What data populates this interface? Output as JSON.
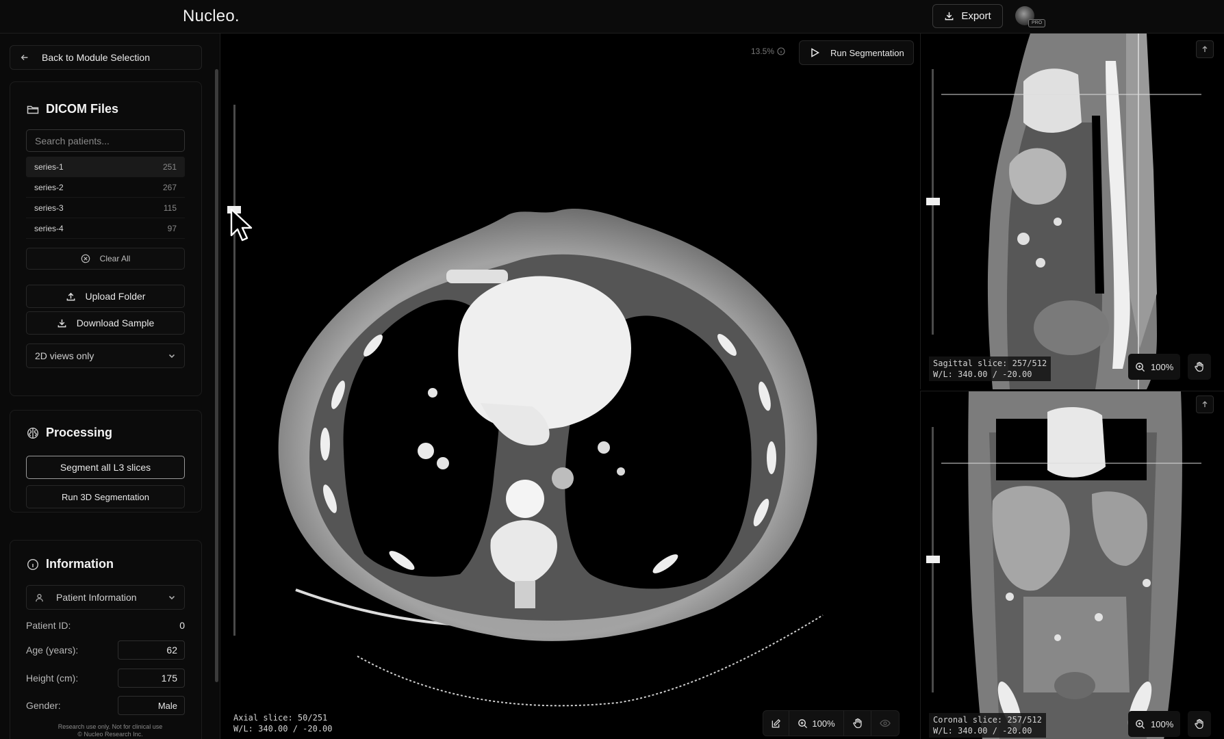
{
  "app": {
    "brand": "Nucleo.",
    "export_label": "Export",
    "pro_badge": "PRO"
  },
  "sidebar": {
    "back_label": "Back to Module Selection",
    "dicom": {
      "title": "DICOM Files",
      "search_placeholder": "Search patients...",
      "series": [
        {
          "name": "series-1",
          "count": "251",
          "active": true
        },
        {
          "name": "series-2",
          "count": "267",
          "active": false
        },
        {
          "name": "series-3",
          "count": "115",
          "active": false
        },
        {
          "name": "series-4",
          "count": "97",
          "active": false
        }
      ],
      "clear_label": "Clear All",
      "upload_label": "Upload Folder",
      "download_label": "Download Sample",
      "view_mode": "2D views only"
    },
    "processing": {
      "title": "Processing",
      "segment_l3_label": "Segment all L3 slices",
      "run_3d_label": "Run 3D Segmentation"
    },
    "information": {
      "title": "Information",
      "patient_info_label": "Patient Information",
      "patient_id_label": "Patient ID:",
      "patient_id_value": "0",
      "age_label": "Age (years):",
      "age_value": "62",
      "height_label": "Height (cm):",
      "height_value": "175",
      "gender_label": "Gender:",
      "gender_value": "Male"
    },
    "footer": {
      "line1": "Research use only. Not for clinical use",
      "line2": "© Nucleo Research Inc."
    }
  },
  "axial": {
    "seg_percent": "13.5%",
    "run_seg_label": "Run Segmentation",
    "slice_text": "Axial slice: 50/251",
    "wl_text": "W/L: 340.00 / -20.00",
    "zoom": "100%",
    "slider_level": 0.19
  },
  "sagittal": {
    "slice_text": "Sagittal slice: 257/512",
    "wl_text": "W/L: 340.00 / -20.00",
    "zoom": "100%"
  },
  "coronal": {
    "slice_text": "Coronal slice: 257/512",
    "wl_text": "W/L: 340.00 / -20.00",
    "zoom": "100%"
  }
}
